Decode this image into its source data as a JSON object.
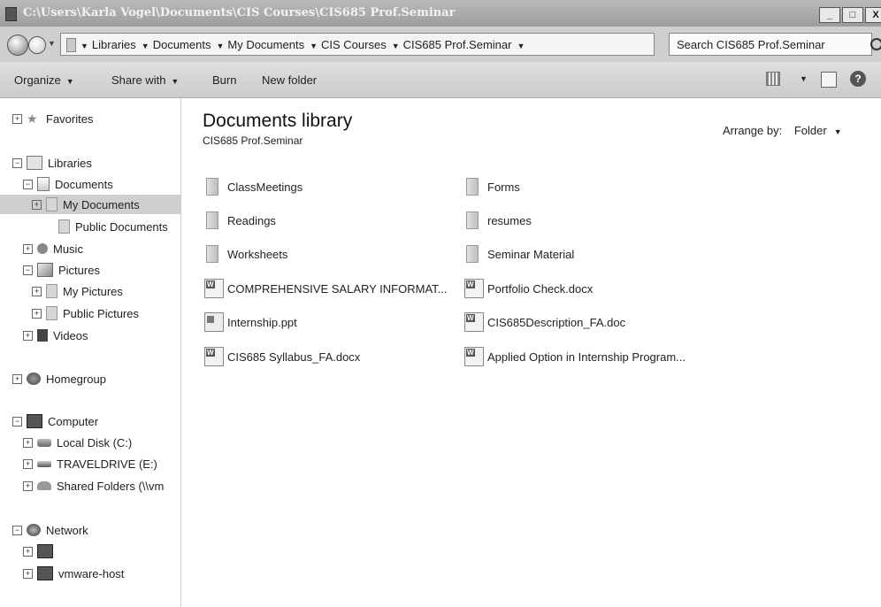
{
  "titlebar": {
    "title": "C:\\Users\\Karla Vogel\\Documents\\CIS Courses\\CIS685 Prof.Seminar",
    "minimize": "_",
    "maximize": "□",
    "close": "X"
  },
  "address": {
    "crumbs": [
      "Libraries",
      "Documents",
      "My Documents",
      "CIS Courses",
      "CIS685 Prof.Seminar"
    ],
    "search_placeholder": "Search CIS685 Prof.Seminar"
  },
  "toolbar": {
    "organize": "Organize",
    "share_with": "Share with",
    "burn": "Burn",
    "new_folder": "New folder"
  },
  "nav": {
    "favorites": "Favorites",
    "libraries": "Libraries",
    "documents": "Documents",
    "my_documents": "My Documents",
    "public_documents": "Public Documents",
    "music": "Music",
    "pictures": "Pictures",
    "my_pictures": "My Pictures",
    "public_pictures": "Public Pictures",
    "videos": "Videos",
    "homegroup": "Homegroup",
    "computer": "Computer",
    "local_disk": "Local Disk (C:)",
    "traveldrive": "TRAVELDRIVE (E:)",
    "shared_folders": "Shared Folders (\\\\vm",
    "network": "Network",
    "vmware_host": "vmware-host"
  },
  "content": {
    "title": "Documents library",
    "subtitle": "CIS685 Prof.Seminar",
    "arrange_label": "Arrange by:",
    "arrange_value": "Folder",
    "items": [
      {
        "label": "ClassMeetings",
        "type": "folder-icon"
      },
      {
        "label": "Forms",
        "type": "folder-icon"
      },
      {
        "label": "Readings",
        "type": "folder-icon"
      },
      {
        "label": "resumes",
        "type": "folder-icon"
      },
      {
        "label": "Worksheets",
        "type": "folder-icon"
      },
      {
        "label": "Seminar Material",
        "type": "folder-icon"
      },
      {
        "label": "COMPREHENSIVE SALARY INFORMAT...",
        "type": "word-doc-icon"
      },
      {
        "label": "Portfolio Check.docx",
        "type": "word-doc-icon"
      },
      {
        "label": "Internship.ppt",
        "type": "powerpoint-icon"
      },
      {
        "label": "CIS685Description_FA.doc",
        "type": "word-doc-icon"
      },
      {
        "label": "CIS685 Syllabus_FA.docx",
        "type": "word-doc-icon"
      },
      {
        "label": "Applied Option in Internship Program...",
        "type": "word-doc-icon"
      }
    ]
  }
}
